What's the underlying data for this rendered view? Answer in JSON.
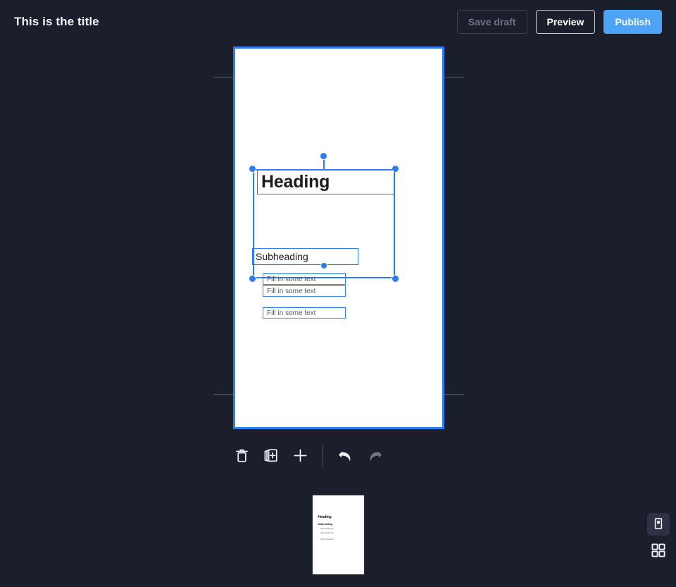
{
  "header": {
    "title": "This is the title",
    "buttons": [
      {
        "label": "Save draft",
        "state": "disabled",
        "name": "save-draft-button"
      },
      {
        "label": "Preview",
        "state": "outline",
        "name": "preview-button"
      },
      {
        "label": "Publish",
        "state": "primary",
        "name": "publish-button"
      }
    ]
  },
  "colors": {
    "background": "#1b1e2b",
    "accent": "#2b7cf6",
    "publish": "#4da3f5",
    "page": "#ffffff",
    "selection": "#2b7cf6",
    "disabled_text": "#6d7386",
    "guide": "#555b70"
  },
  "canvas": {
    "page_background": "#ffffff",
    "selected": true,
    "elements": {
      "heading": "Heading",
      "subheading": "Subheading",
      "line1": "Fill in some text",
      "line2": "Fill in some text",
      "line3": "Fill in some text"
    }
  },
  "toolbar": {
    "items": [
      {
        "name": "delete-button",
        "icon": "trash-icon",
        "label": "Delete",
        "enabled": true
      },
      {
        "name": "duplicate-page-button",
        "icon": "duplicate-page-icon",
        "label": "Duplicate page",
        "enabled": true
      },
      {
        "name": "add-page-button",
        "icon": "plus-icon",
        "label": "Add",
        "enabled": true
      },
      {
        "name": "undo-button",
        "icon": "undo-icon",
        "label": "Undo",
        "enabled": true
      },
      {
        "name": "redo-button",
        "icon": "redo-icon",
        "label": "Redo",
        "enabled": false
      }
    ]
  },
  "thumbnails": {
    "pages": [
      {
        "name": "page-thumbnail-1",
        "heading": "Heading",
        "subheading": "Subheading",
        "line1": "Fill in some text",
        "line2": "Fill in some text",
        "line3": "Fill in some text",
        "active": true
      }
    ]
  },
  "view_modes": [
    {
      "name": "single-page-view-button",
      "icon": "single-page-icon",
      "label": "Single page",
      "active": true
    },
    {
      "name": "grid-view-button",
      "icon": "grid-icon",
      "label": "Grid",
      "active": false
    }
  ]
}
